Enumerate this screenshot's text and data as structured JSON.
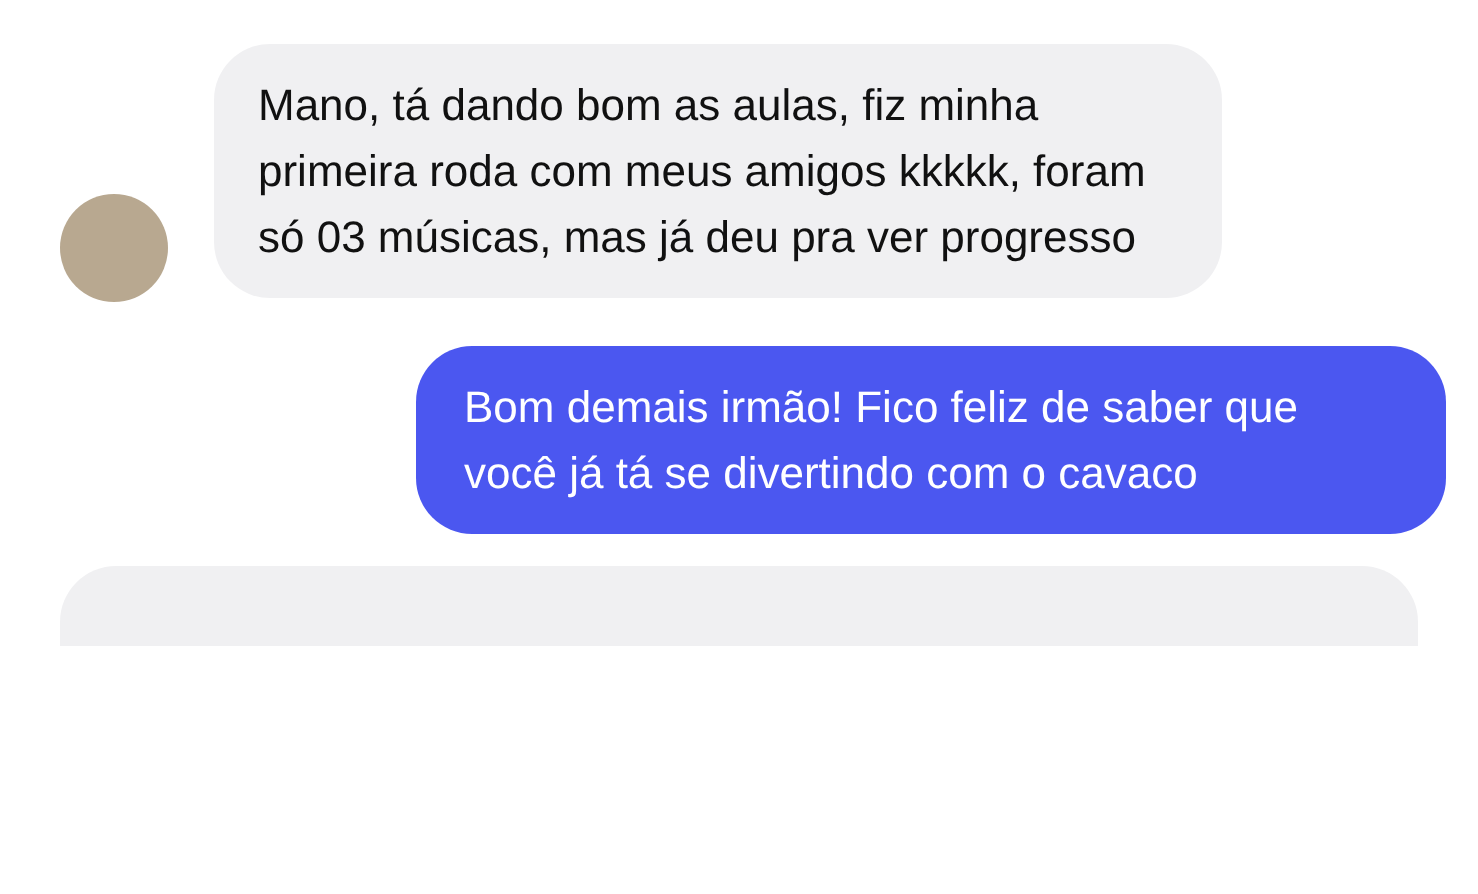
{
  "messages": [
    {
      "kind": "incoming",
      "text": "Mano, tá dando bom as aulas, fiz minha primeira roda com meus amigos kkkkk, foram só 03 músicas, mas já deu pra ver progresso"
    },
    {
      "kind": "outgoing",
      "text": "Bom demais irmão! Fico feliz de saber que você já tá se divertindo com o cavaco"
    }
  ]
}
